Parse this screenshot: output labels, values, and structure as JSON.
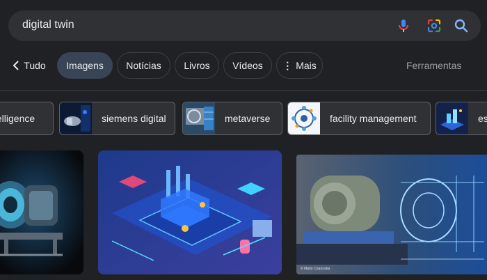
{
  "search": {
    "query": "digital twin"
  },
  "tabs": {
    "back": "Tudo",
    "images": "Imagens",
    "news": "Notícias",
    "books": "Livros",
    "videos": "Vídeos",
    "more": "Mais",
    "tools": "Ferramentas"
  },
  "chips": [
    {
      "label": "telligence"
    },
    {
      "label": "siemens digital"
    },
    {
      "label": "metaverse"
    },
    {
      "label": "facility management"
    },
    {
      "label": "es"
    }
  ],
  "results": [
    {
      "kind": "turbine render"
    },
    {
      "kind": "isometric smart factory"
    },
    {
      "kind": "electric motor with holographic overlay",
      "watermark": "© Mario Corporatia"
    }
  ],
  "colors": {
    "background": "#202124",
    "search_bar": "#303134",
    "active_tab": "#394457",
    "mic_blue": "#4285f4",
    "mic_red": "#ea4335"
  }
}
